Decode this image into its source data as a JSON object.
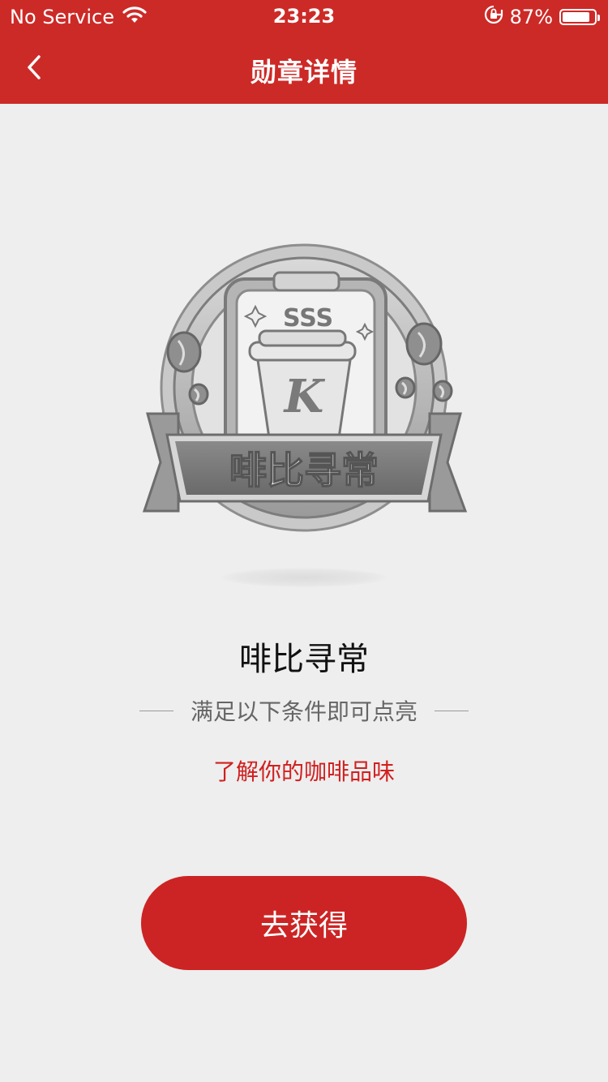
{
  "status_bar": {
    "carrier": "No Service",
    "time": "23:23",
    "battery_percent_text": "87%",
    "battery_level": 0.87,
    "icons": [
      "wifi-icon",
      "orientation-lock-icon",
      "battery-icon"
    ]
  },
  "nav": {
    "title": "勋章详情",
    "back_icon": "chevron-left-icon"
  },
  "badge": {
    "ribbon_text": "啡比寻常",
    "cup_letter": "K",
    "state": "locked-grayscale"
  },
  "detail": {
    "name": "啡比寻常",
    "condition_heading": "满足以下条件即可点亮",
    "task": "了解你的咖啡品味"
  },
  "cta": {
    "label": "去获得"
  },
  "colors": {
    "brand_red": "#cc2a27",
    "task_red": "#d11f1f",
    "background": "#eeeeee"
  }
}
